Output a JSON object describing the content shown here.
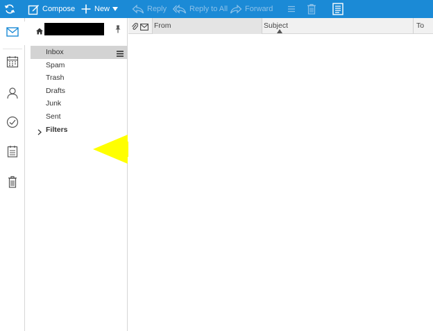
{
  "toolbar": {
    "compose_label": "Compose",
    "new_label": "New",
    "reply_label": "Reply",
    "reply_all_label": "Reply to All",
    "forward_label": "Forward",
    "icons": [
      "refresh-icon",
      "compose-icon",
      "plus-icon",
      "reply-icon",
      "reply-all-icon",
      "forward-icon",
      "menu-icon",
      "trash-icon",
      "document-icon"
    ]
  },
  "rail": {
    "items": [
      "mail-icon",
      "calendar-icon",
      "contacts-icon",
      "tasks-icon",
      "notes-icon",
      "trash-icon"
    ]
  },
  "account": {
    "name": "redacted"
  },
  "folders": [
    {
      "label": "Inbox",
      "selected": true
    },
    {
      "label": "Spam"
    },
    {
      "label": "Trash"
    },
    {
      "label": "Drafts"
    },
    {
      "label": "Junk"
    },
    {
      "label": "Sent"
    },
    {
      "label": "Filters"
    }
  ],
  "list_header": {
    "from": "From",
    "subject": "Subject",
    "to": "To"
  },
  "colors": {
    "toolbar": "#1b8ad6",
    "accent": "#1b8ad6",
    "arrow": "#ffff00",
    "selected_folder": "#d3d3d3"
  }
}
